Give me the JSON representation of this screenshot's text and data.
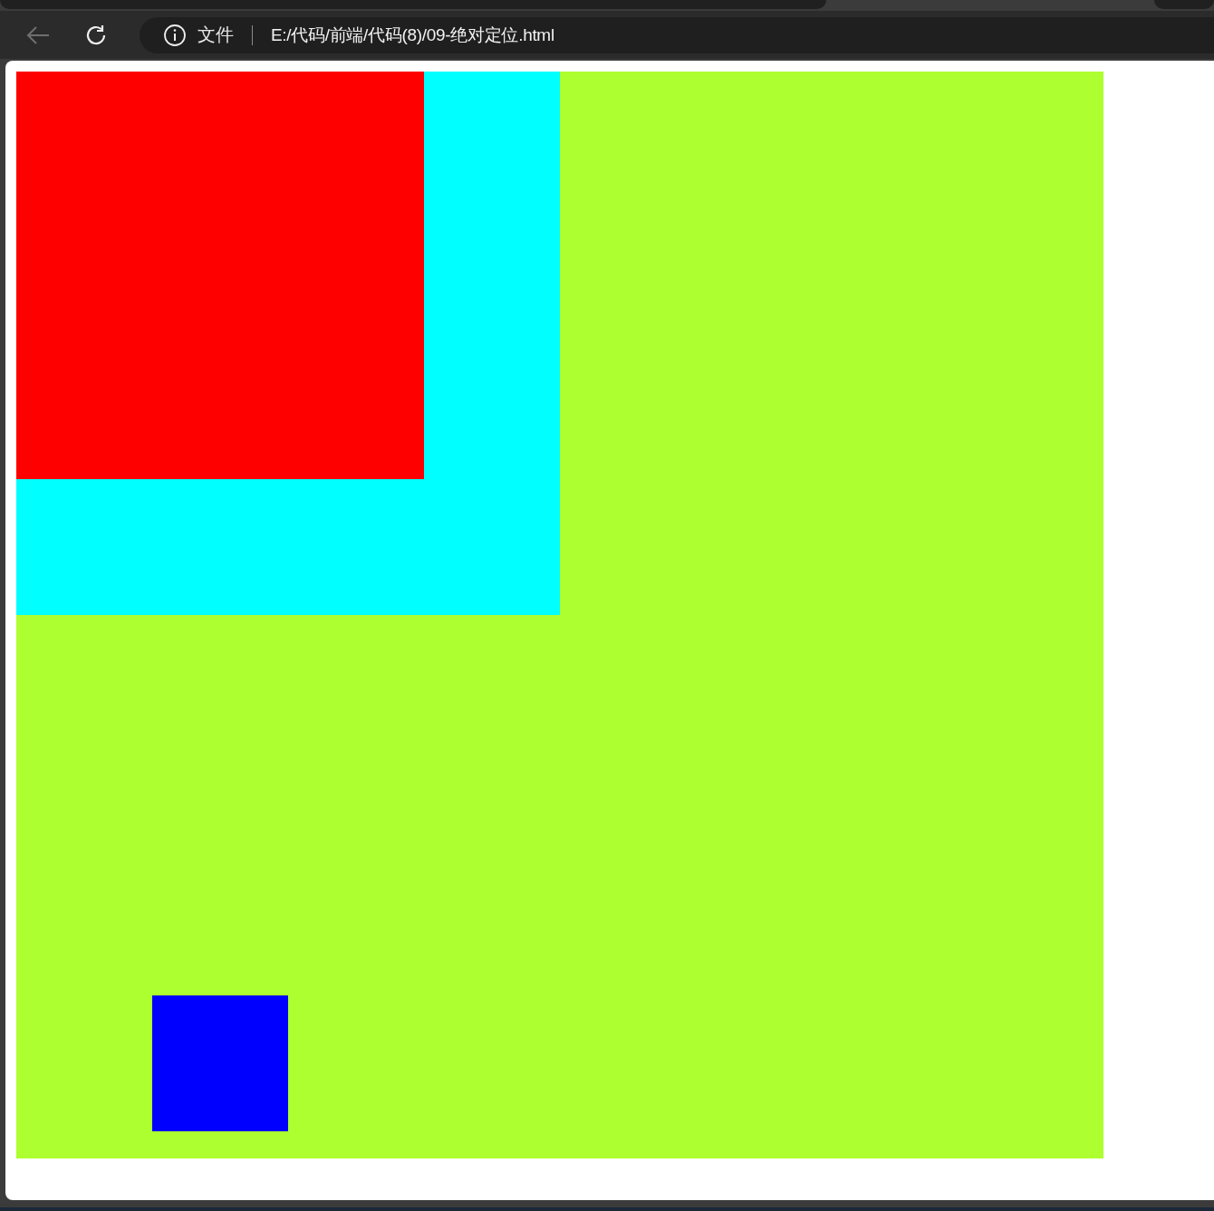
{
  "toolbar": {
    "back": {
      "disabled": true
    },
    "site_info": "文件",
    "address": "E:/代码/前端/代码(8)/09-绝对定位.html"
  },
  "page": {
    "boxes": [
      {
        "kind": "container",
        "color": "#adff2f"
      },
      {
        "kind": "inner",
        "color": "#00ffff"
      },
      {
        "kind": "nested",
        "color": "#ff0000"
      },
      {
        "kind": "absolute",
        "color": "#0000ff"
      }
    ]
  }
}
